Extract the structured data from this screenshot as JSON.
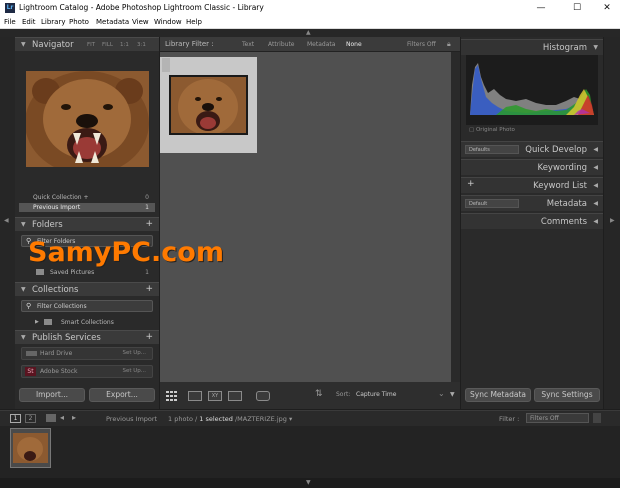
{
  "window": {
    "title": "Lightroom Catalog - Adobe Photoshop Lightroom Classic - Library",
    "app_icon_text": "Lr",
    "minimize": "—",
    "maximize": "☐",
    "close": "✕"
  },
  "menu": [
    "File",
    "Edit",
    "Library",
    "Photo",
    "Metadata",
    "View",
    "Window",
    "Help"
  ],
  "left_panel": {
    "navigator": {
      "label": "Navigator",
      "options": [
        "FIT",
        "FILL",
        "1:1",
        "3:1"
      ]
    },
    "catalog_rows": [
      {
        "label": "Quick Collection +",
        "count": "0"
      },
      {
        "label": "Previous Import",
        "count": "1"
      }
    ],
    "folders": {
      "label": "Folders",
      "filter": "Filter Folders",
      "item_label": "Saved Pictures",
      "item_count": "1"
    },
    "collections": {
      "label": "Collections",
      "filter": "Filter Collections",
      "item_label": "Smart Collections"
    },
    "publish": {
      "label": "Publish Services",
      "services": [
        {
          "label": "Hard Drive",
          "action": "Set Up..."
        },
        {
          "label": "Adobe Stock",
          "action": "Set Up...",
          "badge": "St"
        }
      ]
    },
    "import_button": "Import...",
    "export_button": "Export..."
  },
  "library_filter": {
    "label": "Library Filter :",
    "tabs": [
      "Text",
      "Attribute",
      "Metadata",
      "None"
    ],
    "preset": "Filters Off"
  },
  "toolbar": {
    "sort_label": "Sort:",
    "sort_value": "Capture Time"
  },
  "right_panel": {
    "histogram": "Histogram",
    "original_photo": "Original Photo",
    "quick_develop": "Quick Develop",
    "quick_develop_preset": "Defaults",
    "keywording": "Keywording",
    "keyword_list": "Keyword List",
    "metadata": "Metadata",
    "metadata_preset": "Default",
    "comments": "Comments",
    "sync_metadata": "Sync Metadata",
    "sync_settings": "Sync Settings"
  },
  "filmstrip_bar": {
    "monitor1": "1",
    "monitor2": "2",
    "source": "Previous Import",
    "info_prefix": "1 photo / ",
    "info_selected": "1 selected",
    "info_file": " /MAZTERIZE.jpg",
    "filter_label": "Filter :",
    "filter_value": "Filters Off"
  },
  "watermark": "SamyPC.com"
}
